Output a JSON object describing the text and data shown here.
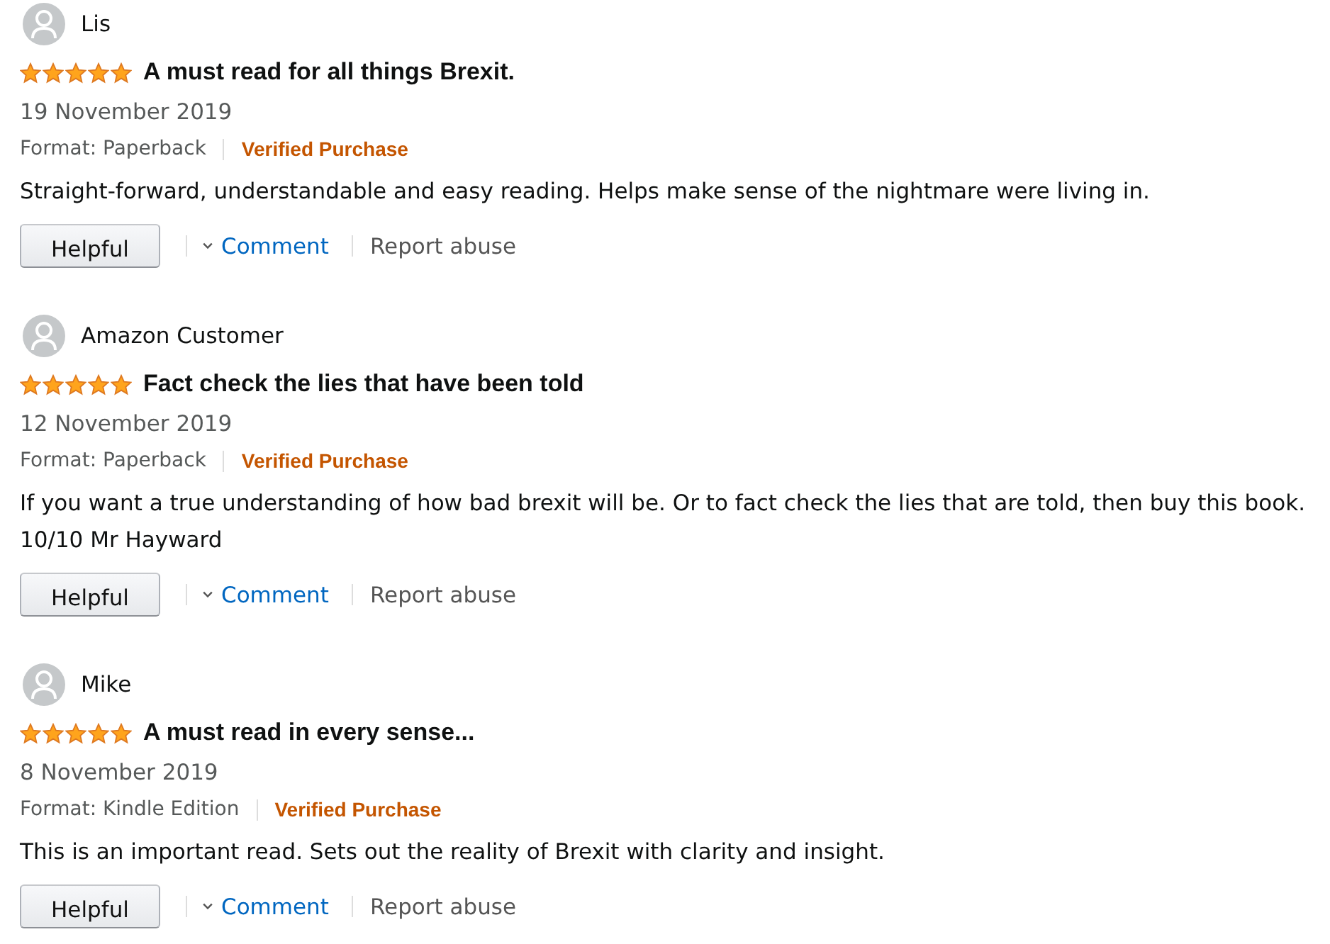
{
  "reviews": [
    {
      "reviewer": "Lis",
      "stars": 5,
      "title": "A must read for all things Brexit.",
      "date": "19 November 2019",
      "format": "Format: Paperback",
      "verified": "Verified Purchase",
      "body": "Straight-forward, understandable and easy reading. Helps make sense of the nightmare were living in.",
      "actions": {
        "helpful": "Helpful",
        "comment": "Comment",
        "report": "Report abuse"
      }
    },
    {
      "reviewer": "Amazon Customer",
      "stars": 5,
      "title": "Fact check the lies that have been told",
      "date": "12 November 2019",
      "format": "Format: Paperback",
      "verified": "Verified Purchase",
      "body": "If you want a true understanding of how bad brexit will be. Or to fact check the lies that are told, then buy this book. 10/10 Mr Hayward",
      "actions": {
        "helpful": "Helpful",
        "comment": "Comment",
        "report": "Report abuse"
      }
    },
    {
      "reviewer": "Mike",
      "stars": 5,
      "title": "A must read in every sense...",
      "date": "8 November 2019",
      "format": "Format: Kindle Edition",
      "verified": "Verified Purchase",
      "body": "This is an important read. Sets out the reality of Brexit with clarity and insight.",
      "actions": {
        "helpful": "Helpful",
        "comment": "Comment",
        "report": "Report abuse"
      }
    }
  ]
}
